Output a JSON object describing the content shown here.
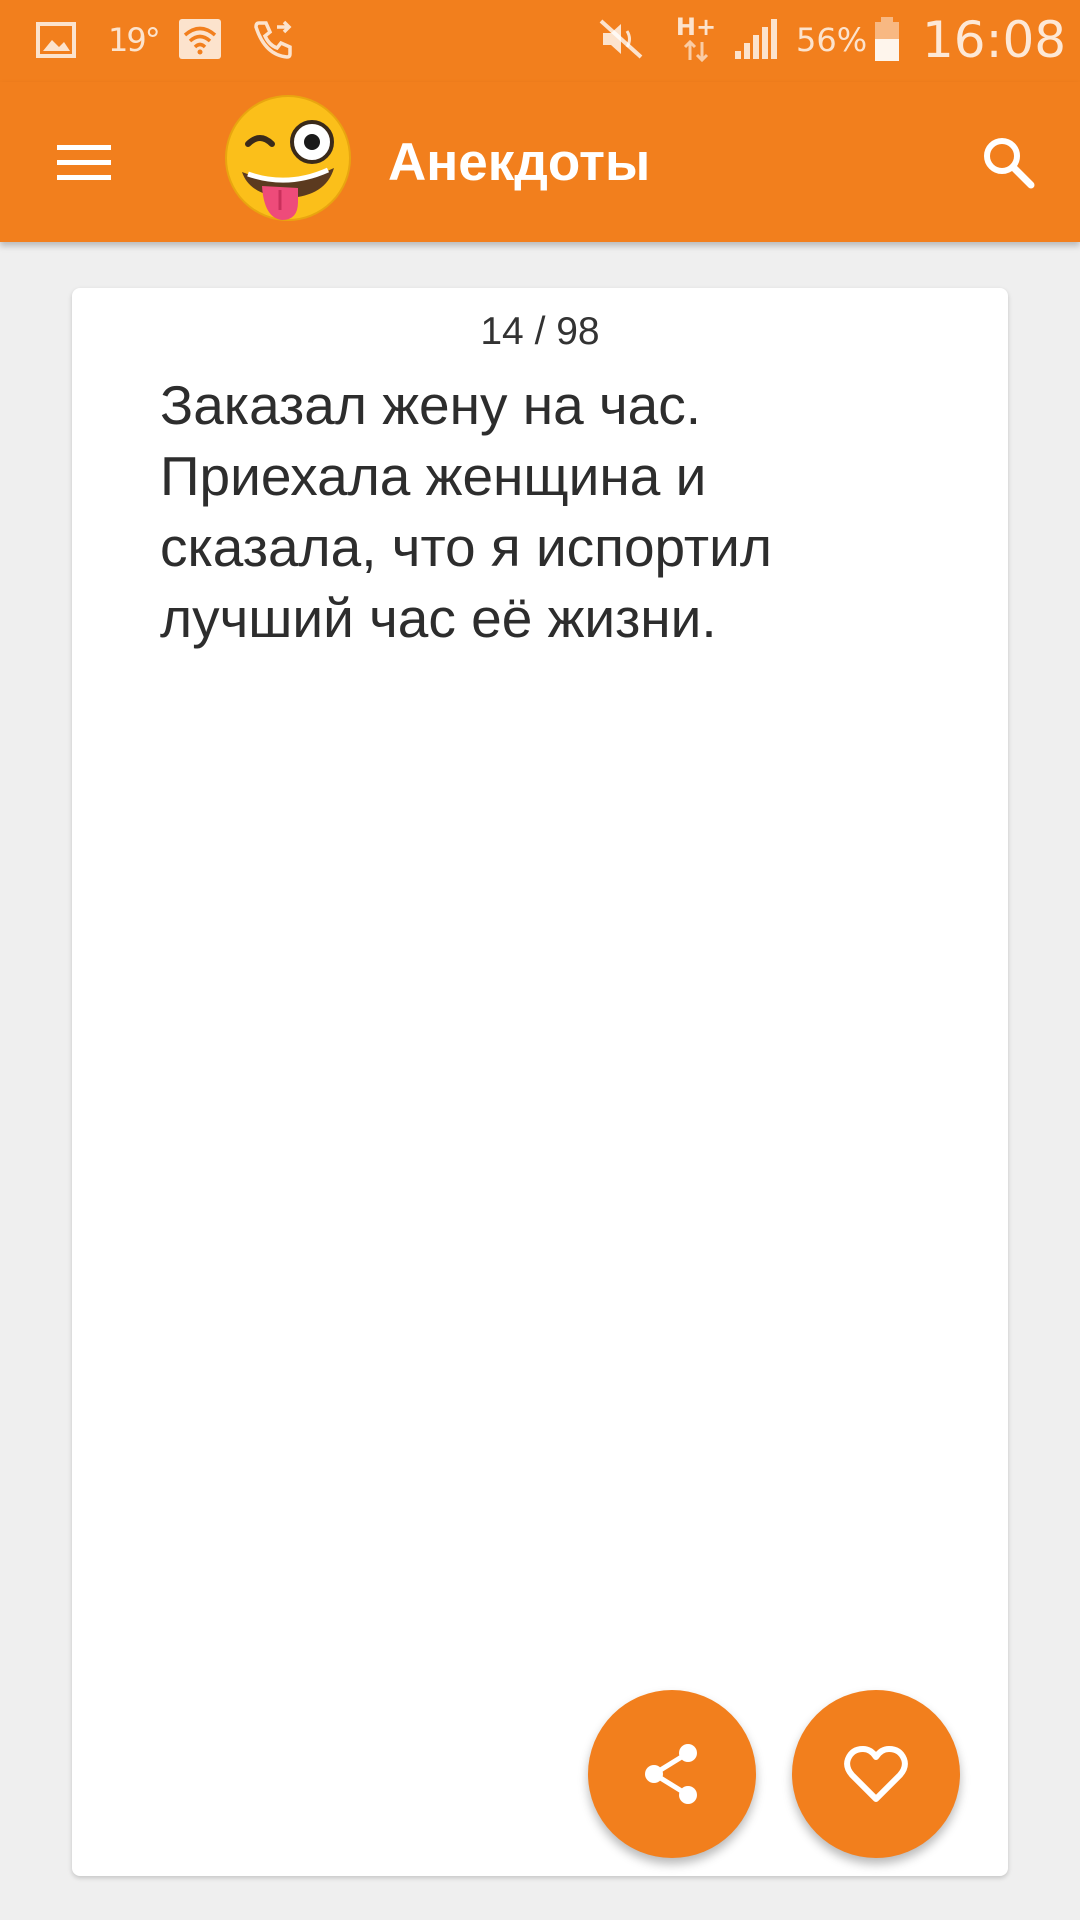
{
  "status_bar": {
    "temperature": "19°",
    "battery_percent": "56%",
    "time": "16:08",
    "network": "H+",
    "icons": [
      "gallery-icon",
      "wifi-icon",
      "call-forward-icon",
      "mute-icon",
      "network-type-icon",
      "signal-icon",
      "battery-icon"
    ]
  },
  "app_bar": {
    "title": "Анекдоты",
    "menu_icon": "menu-icon",
    "logo": "winking-tongue-emoji",
    "search_icon": "search-icon"
  },
  "card": {
    "counter": "14 / 98",
    "joke": "Заказал жену на час. Приехала женщина и сказала, что я испортил лучший час её жизни."
  },
  "actions": {
    "share_icon": "share-icon",
    "like_icon": "heart-icon"
  },
  "colors": {
    "accent": "#f27f1d",
    "background": "#efefef",
    "card": "#ffffff",
    "text": "#2d2d2d"
  }
}
